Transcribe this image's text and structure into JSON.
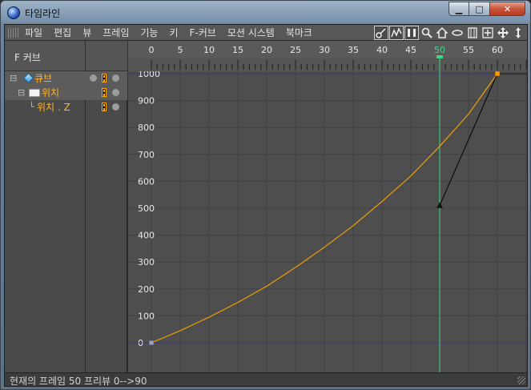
{
  "window": {
    "title": "타임라인",
    "controls": {
      "minimize": "▁",
      "maximize": "□",
      "close": "✕"
    }
  },
  "menu": {
    "items": [
      "파일",
      "편집",
      "뷰",
      "프레임",
      "기능",
      "키",
      "F-커브",
      "모션 시스템",
      "북마크"
    ]
  },
  "toolbar": {
    "icons": [
      "key-mode-icon",
      "fcurve-mode-icon",
      "ripple-mode-icon",
      "search-icon",
      "home-icon",
      "link-icon",
      "fit-icon",
      "add-icon",
      "move-icon",
      "arrow-down-icon"
    ]
  },
  "left_panel": {
    "header": "F 커브",
    "tree": [
      {
        "label": "큐브",
        "indent": 0,
        "type": "object"
      },
      {
        "label": "위치",
        "indent": 1,
        "type": "folder"
      },
      {
        "label": "위치 . Z",
        "indent": 2,
        "type": "track"
      }
    ]
  },
  "timeline": {
    "ruler_labels": [
      "0",
      "5",
      "10",
      "15",
      "20",
      "25",
      "30",
      "35",
      "40",
      "45",
      "50",
      "55",
      "60"
    ],
    "current_frame": 50,
    "current_frame_label": "50",
    "y_labels": [
      "1000",
      "900",
      "800",
      "700",
      "600",
      "500",
      "400",
      "300",
      "200",
      "100",
      "0"
    ]
  },
  "chart_data": {
    "type": "line",
    "x_unit": "frame",
    "xlim": [
      0,
      60
    ],
    "ylim": [
      0,
      1000
    ],
    "series": [
      {
        "x": [
          0,
          5,
          10,
          15,
          20,
          25,
          30,
          35,
          40,
          45,
          50,
          55,
          60
        ],
        "y": [
          0,
          45,
          95,
          150,
          210,
          280,
          355,
          435,
          525,
          620,
          730,
          850,
          1000
        ]
      }
    ],
    "keys": [
      {
        "frame": 0,
        "value": 0
      },
      {
        "frame": 60,
        "value": 1000
      }
    ],
    "tangent_handle": {
      "frame": 50,
      "value": 510
    },
    "guides": [
      0,
      1000
    ],
    "colors": {
      "curve": "#f0a000",
      "guide": "#3030c0",
      "cursor": "#41d483",
      "tangent": "#000000",
      "key_end": "#ff9900",
      "key_start": "#9aa6c8"
    }
  },
  "status": {
    "text": "현재의 프레임  50  프리뷰  0-->90"
  }
}
